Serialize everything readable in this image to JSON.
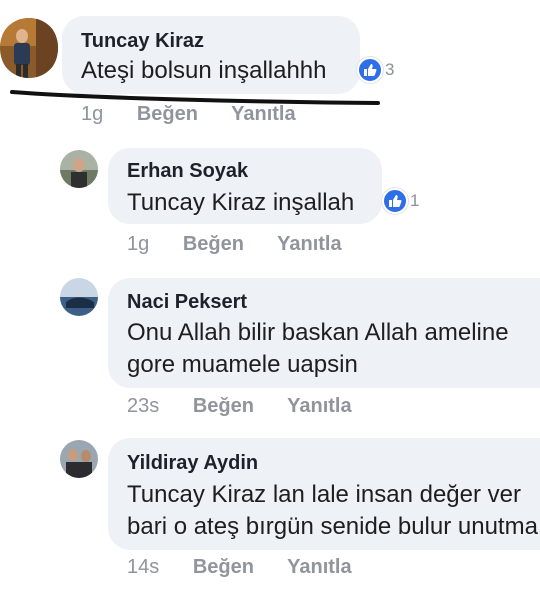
{
  "comments": [
    {
      "author": "Tuncay Kiraz",
      "text": "Ateşi bolsun inşallahhh",
      "reaction_count": "3",
      "time": "1g",
      "like": "Beğen",
      "reply": "Yanıtla"
    },
    {
      "author": "Erhan Soyak",
      "text": "Tuncay Kiraz inşallah",
      "reaction_count": "1",
      "time": "1g",
      "like": "Beğen",
      "reply": "Yanıtla"
    },
    {
      "author": "Naci Peksert",
      "text_lines": [
        "Onu Allah bilir baskan Allah ameline",
        "gore muamele uapsin"
      ],
      "time": "23s",
      "like": "Beğen",
      "reply": "Yanıtla"
    },
    {
      "author": "Yildiray Aydin",
      "text_lines": [
        "Tuncay Kiraz lan lale insan  değer ver",
        "bari o ateş bırgün senide bulur unutma"
      ],
      "time": "14s",
      "like": "Beğen",
      "reply": "Yanıtla"
    }
  ],
  "icons": {
    "like": "thumbs-up-icon",
    "avatar": "user-photo"
  },
  "colors": {
    "bubble": "#eef1f5",
    "like_blue": "#2e6fe8",
    "meta_gray": "#90949c",
    "ink_line": "#111111"
  }
}
